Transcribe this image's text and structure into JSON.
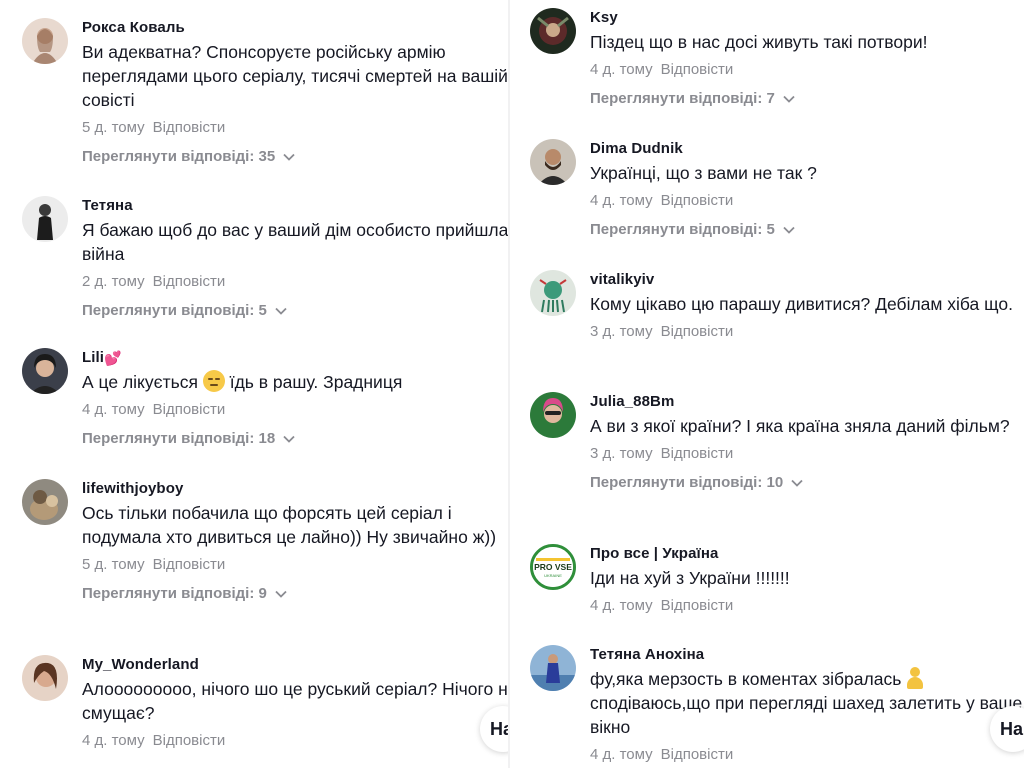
{
  "left": {
    "comments": [
      {
        "username": "Рокса Коваль",
        "text": "Ви адекватна? Спонсоруєте російську армію переглядами цього серіалу, тисячі смертей на вашій совісті",
        "time": "5 д. тому",
        "reply": "Відповісти",
        "view_replies": "Переглянути відповіді: 35"
      },
      {
        "username": "Тетяна",
        "text": "Я бажаю щоб до вас у ваший дім особисто прийшла війна",
        "time": "2 д. тому",
        "reply": "Відповісти",
        "view_replies": "Переглянути відповіді: 5"
      },
      {
        "username": "Lili",
        "text_before": "А це лікується",
        "text_after": "їдь в рашу. Зрадниця",
        "time": "4 д. тому",
        "reply": "Відповісти",
        "view_replies": "Переглянути відповіді: 18"
      },
      {
        "username": "lifewithjoyboy",
        "text": "Ось тільки побачила що форсять цей серіал і подумала хто дивиться це лайно)) Ну звичайно ж))",
        "time": "5 д. тому",
        "reply": "Відповісти",
        "view_replies": "Переглянути відповіді: 9"
      },
      {
        "username": "My_Wonderland",
        "text": "Алооооооооо, нічого шо це руський серіал? Нічого не смущає?",
        "time": "4 д. тому",
        "reply": "Відповісти"
      }
    ],
    "float_label": "На"
  },
  "right": {
    "comments": [
      {
        "username": "Ksy",
        "text": "Піздец що в нас досі живуть такі потвори!",
        "time": "4 д. тому",
        "reply": "Відповісти",
        "view_replies": "Переглянути відповіді: 7"
      },
      {
        "username": "Dima Dudnik",
        "text": "Українці, що з вами не так ?",
        "time": "4 д. тому",
        "reply": "Відповісти",
        "view_replies": "Переглянути відповіді: 5"
      },
      {
        "username": "vitalikyiv",
        "text": "Кому цікаво цю парашу дивитися? Дебілам хіба що.",
        "time": "3 д. тому",
        "reply": "Відповісти"
      },
      {
        "username": "Julia_88Bm",
        "text": "А ви з якої країни? І яка країна зняла даний фільм?",
        "time": "3 д. тому",
        "reply": "Відповісти",
        "view_replies": "Переглянути відповіді: 10"
      },
      {
        "username": "Про все | Україна",
        "text": "Іди на хуй з України !!!!!!!",
        "time": "4 д. тому",
        "reply": "Відповісти",
        "avatar_text": "PRO VSE",
        "avatar_subtext": "UKRAINE"
      },
      {
        "username": "Тетяна Анохіна",
        "text_before": "фу,яка мерзость в коментах зібралась",
        "text_after": "сподіваюсь,що при перегляді шахед залетить у ваше вікно",
        "time": "4 д. тому",
        "reply": "Відповісти"
      }
    ],
    "float_label": "На"
  },
  "colors": {
    "text": "#161823",
    "muted": "#8a8b91",
    "background": "#ffffff",
    "heart": "#e84a8c",
    "pro_vse_green": "#2f8f3a"
  },
  "icons": {
    "chevron": "chevron-down-icon",
    "heart": "heart-emoji-icon",
    "face": "pensive-face-emoji-icon",
    "person": "person-emoji-icon"
  }
}
